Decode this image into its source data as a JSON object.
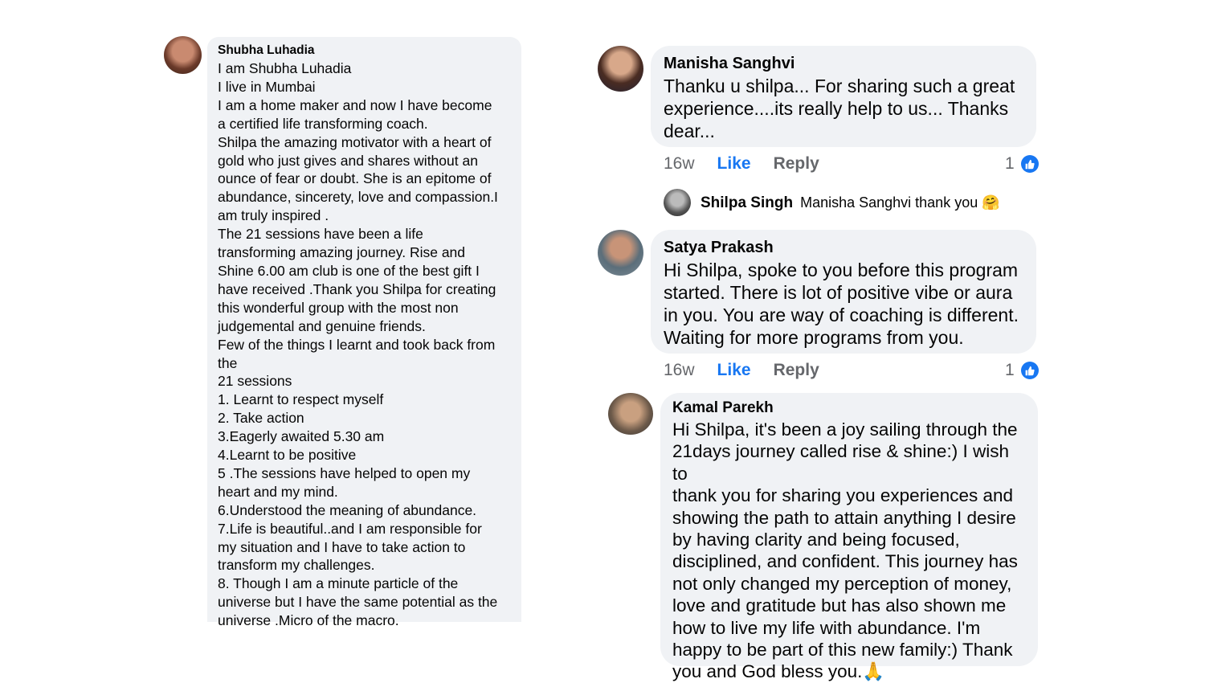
{
  "comments": [
    {
      "name": "Shubha Luhadia",
      "text": "I am Shubha Luhadia\nI live in Mumbai\nI am a home maker and now I have become\na certified life transforming  coach.\nShilpa the amazing motivator  with a heart of\ngold who just gives and shares without an\nounce of fear or doubt. She is an epitome of\nabundance, sincerety, love and compassion.I\nam truly inspired .\nThe 21 sessions have been a life\ntransforming amazing journey. Rise  and\nShine 6.00 am club is one of   the best gift I\nhave received .Thank you Shilpa for creating\nthis wonderful group with the most non\njudgemental  and genuine friends.\nFew of the things I learnt and took back from\nthe\n 21 sessions\n1. Learnt to respect myself\n2. Take action\n3.Eagerly awaited 5.30 am\n4.Learnt to be positive\n5 .The sessions have helped to open my\nheart  and my mind.\n6.Understood the meaning of abundance.\n7.Life is beautiful..and I am responsible for\nmy  situation and I have to take action to\ntransform my challenges.\n8. Though I am a minute particle of the\nuniverse but I have the same potential as the\nuniverse .Micro of the macro."
    },
    {
      "name": "Manisha Sanghvi",
      "text": "Thanku u shilpa... For sharing such a great\nexperience....its really help to us... Thanks\ndear...",
      "time": "16w",
      "like": "Like",
      "reply": "Reply",
      "reactions": "1"
    },
    {
      "name": "Shilpa Singh",
      "text": "Manisha Sanghvi thank you 🤗"
    },
    {
      "name": "Satya Prakash",
      "text": "Hi Shilpa, spoke to you before this program\nstarted. There is lot of positive vibe or aura\nin you. You are way of coaching is different.\nWaiting for more programs from you.",
      "time": "16w",
      "like": "Like",
      "reply": "Reply",
      "reactions": "1"
    },
    {
      "name": "Kamal Parekh",
      "text": "Hi Shilpa, it's been a joy sailing through the\n21days journey called rise & shine:) I wish to\nthank you for sharing you experiences and\nshowing the path to attain anything I desire\nby having clarity and being focused,\ndisciplined, and confident. This journey has\nnot only changed my perception of money,\nlove and gratitude but has also shown me\nhow to live my life with abundance. I'm\nhappy to be part of this new family:) Thank\nyou and God bless you.🙏"
    }
  ],
  "colors": {
    "bubble": "#f0f2f5",
    "link_blue": "#1877f2",
    "meta_gray": "#65676b"
  }
}
